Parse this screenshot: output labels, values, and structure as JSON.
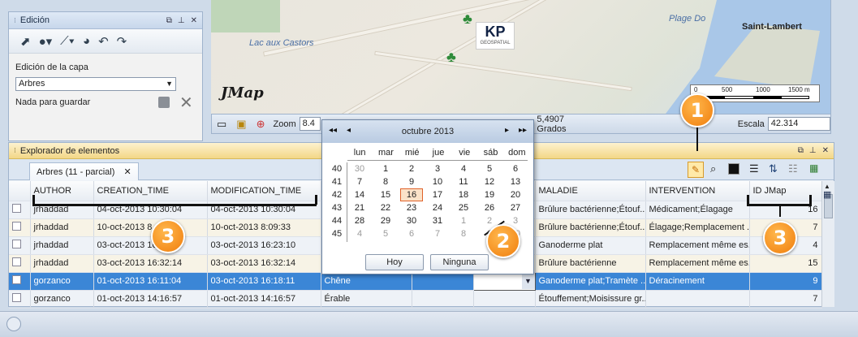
{
  "edit_panel": {
    "title": "Edición",
    "layer_label": "Edición de la capa",
    "layer_value": "Arbres",
    "status": "Nada para guardar"
  },
  "map": {
    "labels": {
      "lake": "Lac aux Castors",
      "beach": "Plage Do",
      "city": "Saint-Lambert",
      "brand": "JMap",
      "logo_sub": "GEOSPATIAL"
    },
    "scale_ticks": [
      "0",
      "500",
      "1000",
      "1500 m"
    ],
    "zoom_label": "Zoom",
    "zoom_value": "8.4",
    "coords": "5,4907 Grados",
    "scale_label": "Escala",
    "scale_value": "42.314"
  },
  "explorer": {
    "title": "Explorador de elementos",
    "tab": "Arbres (11 - parcial)",
    "columns": [
      "AUTHOR",
      "CREATION_TIME",
      "MODIFICATION_TIME",
      "",
      "",
      "MALADIE",
      "INTERVENTION",
      "ID JMap"
    ],
    "rows": [
      [
        "jrhaddad",
        "04-oct-2013 10:30:04",
        "04-oct-2013 10:30:04",
        "",
        "",
        "Brûlure bactérienne;Étouf...",
        "Médicament;Élagage",
        "16"
      ],
      [
        "jrhaddad",
        "10-oct-2013 8",
        "10-oct-2013 8:09:33",
        "",
        "",
        "Brûlure bactérienne;Étouf...",
        "Élagage;Remplacement ...",
        "7"
      ],
      [
        "jrhaddad",
        "03-oct-2013 16:23:10",
        "03-oct-2013 16:23:10",
        "",
        "",
        "Ganoderme plat",
        "Remplacement même es...",
        "4"
      ],
      [
        "jrhaddad",
        "03-oct-2013 16:32:14",
        "03-oct-2013 16:32:14",
        "",
        "",
        "Brûlure bactérienne",
        "Remplacement même es...",
        "15"
      ],
      [
        "gorzanco",
        "01-oct-2013 16:11:04",
        "03-oct-2013 16:18:11",
        "Chêne",
        "",
        "Ganoderme plat;Tramète ...",
        "Déracinement",
        "9"
      ],
      [
        "gorzanco",
        "01-oct-2013 14:16:57",
        "01-oct-2013 14:16:57",
        "Érable",
        "",
        "Étouffement;Moisissure gr...",
        "",
        "7"
      ]
    ]
  },
  "calendar": {
    "month": "octubre",
    "year": "2013",
    "weekdays": [
      "lun",
      "mar",
      "mié",
      "jue",
      "vie",
      "sáb",
      "dom"
    ],
    "weeks": [
      {
        "wk": "40",
        "days": [
          "30",
          "1",
          "2",
          "3",
          "4",
          "5",
          "6"
        ]
      },
      {
        "wk": "41",
        "days": [
          "7",
          "8",
          "9",
          "10",
          "11",
          "12",
          "13"
        ]
      },
      {
        "wk": "42",
        "days": [
          "14",
          "15",
          "16",
          "17",
          "18",
          "19",
          "20"
        ]
      },
      {
        "wk": "43",
        "days": [
          "21",
          "22",
          "23",
          "24",
          "25",
          "26",
          "27"
        ]
      },
      {
        "wk": "44",
        "days": [
          "28",
          "29",
          "30",
          "31",
          "1",
          "2",
          "3"
        ]
      },
      {
        "wk": "45",
        "days": [
          "4",
          "5",
          "6",
          "7",
          "8",
          "9",
          "10"
        ]
      }
    ],
    "today": "16",
    "today_btn": "Hoy",
    "none_btn": "Ninguna"
  },
  "callouts": [
    "1",
    "2",
    "3",
    "3"
  ],
  "colors": {
    "selection": "#3b86d6",
    "callout": "#f07d0c",
    "today_border": "#e0622a"
  }
}
